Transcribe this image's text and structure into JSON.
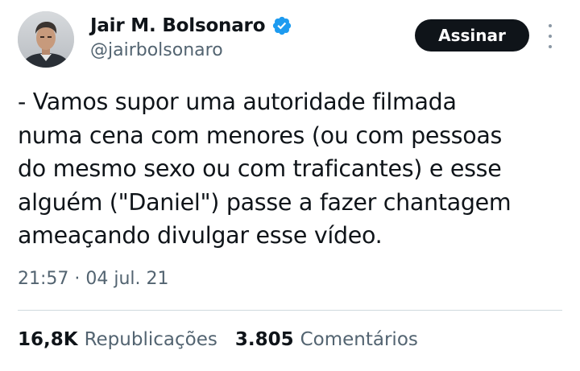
{
  "author": {
    "display_name": "Jair M. Bolsonaro",
    "handle": "@jairbolsonaro",
    "avatar_icon": "profile-photo",
    "verified_icon": "verified-badge-icon",
    "verified_color": "#1d9bf0"
  },
  "actions": {
    "subscribe_label": "Assinar",
    "more_icon": "more-vertical-icon"
  },
  "tweet": {
    "lines": [
      "- Vamos supor uma autoridade filmada",
      "numa cena com menores (ou com pessoas",
      "do mesmo sexo ou com traficantes) e esse",
      "alguém (\"Daniel\") passe a fazer chantagem",
      "ameaçando divulgar esse vídeo."
    ],
    "timestamp": "21:57 · 04 jul. 21"
  },
  "stats": {
    "reposts_count": "16,8K",
    "reposts_label": "Republicações",
    "comments_count": "3.805",
    "comments_label": "Comentários"
  },
  "colors": {
    "text": "#0f1419",
    "secondary": "#536471",
    "button_bg": "#0f1419",
    "divider": "#cfd9de"
  }
}
